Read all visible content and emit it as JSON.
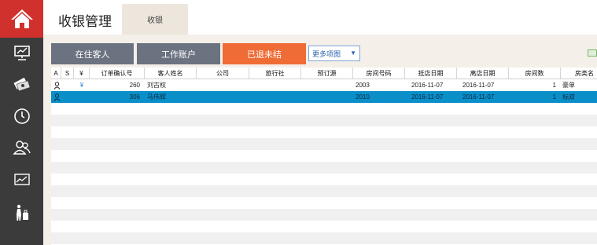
{
  "header": {
    "title": "收银管理",
    "tab_label": "收银"
  },
  "sidebar": {
    "items": [
      {
        "name": "home-icon"
      },
      {
        "name": "presentation-chart-icon"
      },
      {
        "name": "money-icon"
      },
      {
        "name": "clock-icon"
      },
      {
        "name": "users-icon"
      },
      {
        "name": "line-chart-icon"
      },
      {
        "name": "luggage-person-icon"
      }
    ]
  },
  "toolbar": {
    "guests_button": "在住客人",
    "accounts_button": "工作账户",
    "checked_out_button": "已退未结",
    "more_select": "更多项图"
  },
  "table": {
    "columns": [
      "A",
      "S",
      "¥",
      "订单确认号",
      "客人姓名",
      "公司",
      "旅行社",
      "预订源",
      "房间号码",
      "抵店日期",
      "离店日期",
      "房间数",
      "房类名"
    ],
    "rows": [
      {
        "yen": "¥",
        "order_no": "260",
        "guest_name": "刘古权",
        "company": "",
        "agency": "",
        "source": "",
        "room_no": "2003",
        "arrival": "2016-11-07",
        "departure": "2016-11-07",
        "room_count": "1",
        "room_type": "豪单"
      },
      {
        "yen": "",
        "order_no": "306",
        "guest_name": "马伟辉",
        "company": "",
        "agency": "",
        "source": "",
        "room_no": "2010",
        "arrival": "2016-11-07",
        "departure": "2016-11-07",
        "room_count": "1",
        "room_type": "标双"
      }
    ]
  },
  "colors": {
    "accent_red": "#d0312d",
    "button_gray": "#6b7280",
    "button_orange": "#ef6c36",
    "selected_row": "#0a8fc9",
    "sidebar_bg": "#3b3b3b"
  }
}
